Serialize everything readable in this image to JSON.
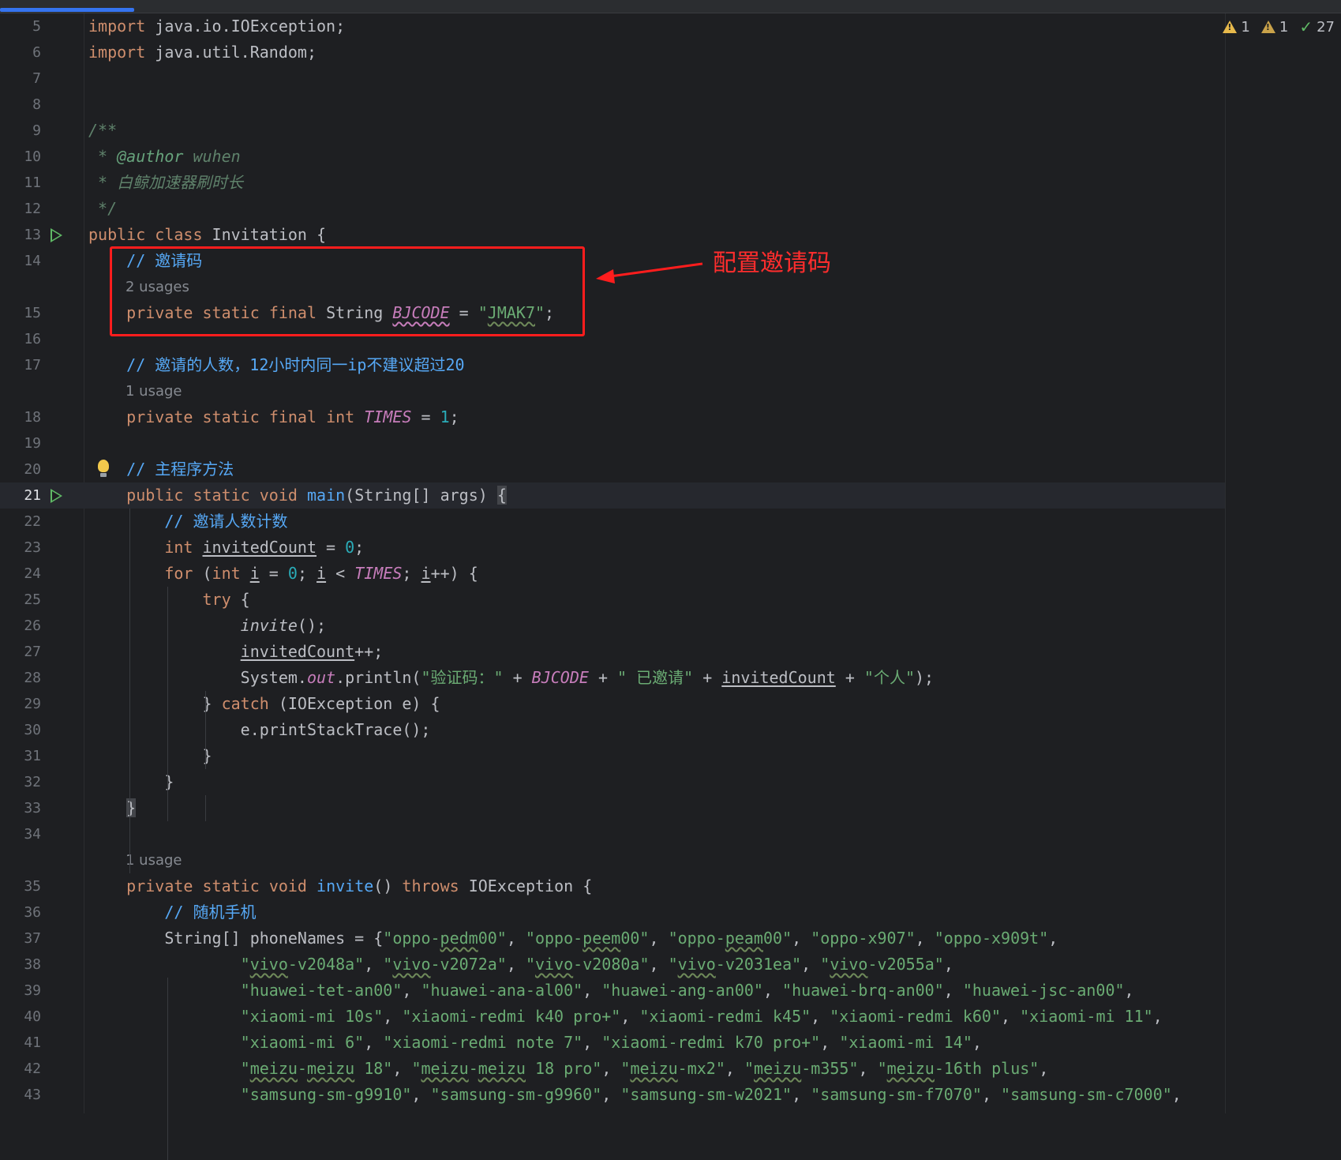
{
  "editor": {
    "inspections": {
      "warnings_a": "1",
      "warnings_b": "1",
      "ok": "27"
    },
    "annotation": {
      "label": "配置邀请码"
    },
    "lines": [
      {
        "n": "5",
        "text": "import java.io.IOException;"
      },
      {
        "n": "6",
        "text": "import java.util.Random;"
      },
      {
        "n": "7",
        "text": ""
      },
      {
        "n": "8",
        "text": ""
      },
      {
        "n": "9",
        "text": "/**"
      },
      {
        "n": "10",
        "text": " * @author wuhen"
      },
      {
        "n": "11",
        "text": " * 白鲸加速器刷时长"
      },
      {
        "n": "12",
        "text": " */"
      },
      {
        "n": "13",
        "text": "public class Invitation {"
      },
      {
        "n": "14",
        "text": "    // 邀请码"
      },
      {
        "n": "",
        "text": "2 usages"
      },
      {
        "n": "15",
        "text": "    private static final String BJCODE = \"JMAK7\";"
      },
      {
        "n": "16",
        "text": ""
      },
      {
        "n": "17",
        "text": "    // 邀请的人数，12小时内同一ip不建议超过20"
      },
      {
        "n": "",
        "text": "1 usage"
      },
      {
        "n": "18",
        "text": "    private static final int TIMES = 1;"
      },
      {
        "n": "19",
        "text": ""
      },
      {
        "n": "20",
        "text": "    // 主程序方法"
      },
      {
        "n": "21",
        "text": "    public static void main(String[] args) {"
      },
      {
        "n": "22",
        "text": "        // 邀请人数计数"
      },
      {
        "n": "23",
        "text": "        int invitedCount = 0;"
      },
      {
        "n": "24",
        "text": "        for (int i = 0; i < TIMES; i++) {"
      },
      {
        "n": "25",
        "text": "            try {"
      },
      {
        "n": "26",
        "text": "                invite();"
      },
      {
        "n": "27",
        "text": "                invitedCount++;"
      },
      {
        "n": "28",
        "text": "                System.out.println(\"验证码：\" + BJCODE + \" 已邀请\" + invitedCount + \"个人\");"
      },
      {
        "n": "29",
        "text": "            } catch (IOException e) {"
      },
      {
        "n": "30",
        "text": "                e.printStackTrace();"
      },
      {
        "n": "31",
        "text": "            }"
      },
      {
        "n": "32",
        "text": "        }"
      },
      {
        "n": "33",
        "text": "    }"
      },
      {
        "n": "34",
        "text": ""
      },
      {
        "n": "",
        "text": "1 usage"
      },
      {
        "n": "35",
        "text": "    private static void invite() throws IOException {"
      },
      {
        "n": "36",
        "text": "        // 随机手机"
      },
      {
        "n": "37",
        "text": "        String[] phoneNames = {\"oppo-pedm00\", \"oppo-peem00\", \"oppo-peam00\", \"oppo-x907\", \"oppo-x909t\","
      },
      {
        "n": "38",
        "text": "                \"vivo-v2048a\", \"vivo-v2072a\", \"vivo-v2080a\", \"vivo-v2031ea\", \"vivo-v2055a\","
      },
      {
        "n": "39",
        "text": "                \"huawei-tet-an00\", \"huawei-ana-al00\", \"huawei-ang-an00\", \"huawei-brq-an00\", \"huawei-jsc-an00\","
      },
      {
        "n": "40",
        "text": "                \"xiaomi-mi 10s\", \"xiaomi-redmi k40 pro+\", \"xiaomi-redmi k45\", \"xiaomi-redmi k60\", \"xiaomi-mi 11\","
      },
      {
        "n": "41",
        "text": "                \"xiaomi-mi 6\", \"xiaomi-redmi note 7\", \"xiaomi-redmi k70 pro+\", \"xiaomi-mi 14\","
      },
      {
        "n": "42",
        "text": "                \"meizu-meizu 18\", \"meizu-meizu 18 pro\", \"meizu-mx2\", \"meizu-m355\", \"meizu-16th plus\","
      },
      {
        "n": "43",
        "text": "                \"samsung-sm-g9910\", \"samsung-sm-g9960\", \"samsung-sm-w2021\", \"samsung-sm-f7070\", \"samsung-sm-c7000\","
      }
    ]
  }
}
